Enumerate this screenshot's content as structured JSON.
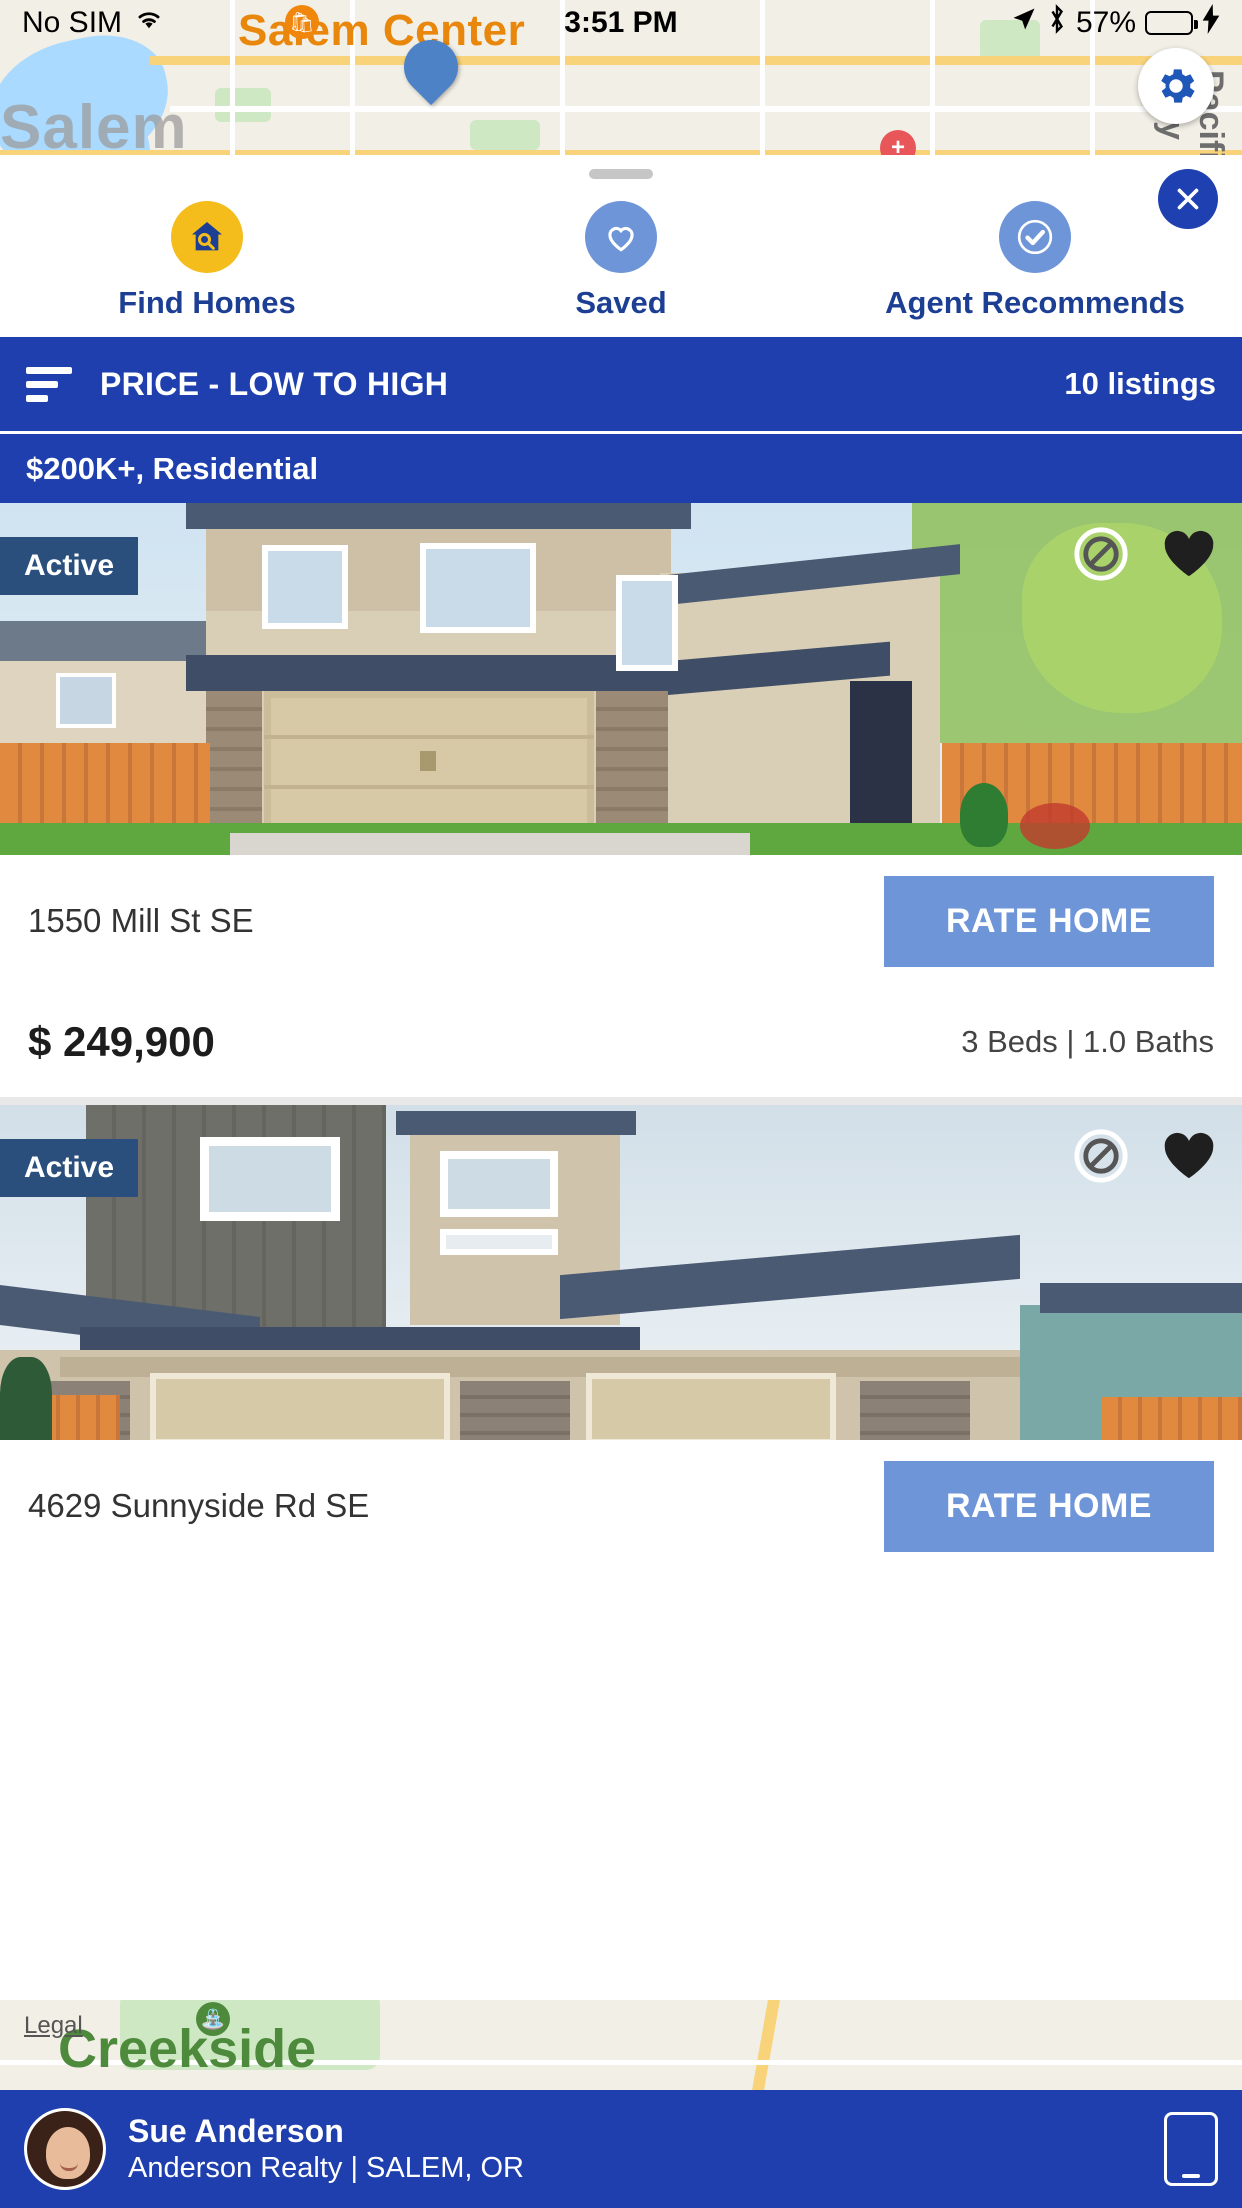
{
  "status_bar": {
    "carrier": "No SIM",
    "wifi_icon": "wifi-icon",
    "time": "3:51 PM",
    "location_icon": "location-arrow-icon",
    "bluetooth_icon": "bluetooth-icon",
    "battery_percent": "57%",
    "charging_icon": "lightning-bolt-icon"
  },
  "map": {
    "city_label": "Salem",
    "center_label": "Salem Center",
    "highway_label": "Pacific Hwy",
    "settings_icon": "gear-icon"
  },
  "sheet": {
    "close_icon": "close-icon",
    "actions": [
      {
        "label": "Find Homes",
        "icon": "home-search-icon",
        "color": "#f5bd1c"
      },
      {
        "label": "Saved",
        "icon": "heart-icon",
        "color": "#6e95d8"
      },
      {
        "label": "Agent Recommends",
        "icon": "check-circle-icon",
        "color": "#6e95d8"
      }
    ],
    "sort": {
      "icon": "sort-icon",
      "label": "PRICE - LOW TO HIGH",
      "count": "10 listings"
    },
    "filter": {
      "label": "$200K+, Residential"
    }
  },
  "listings": [
    {
      "status": "Active",
      "address": "1550 Mill St SE",
      "rate_label": "RATE HOME",
      "price": "$ 249,900",
      "beds_baths": "3 Beds | 1.0 Baths",
      "hide_icon": "hide-listing-icon",
      "favorite_icon": "heart-filled-icon"
    },
    {
      "status": "Active",
      "address": "4629 Sunnyside Rd SE",
      "rate_label": "RATE HOME",
      "price": "",
      "beds_baths": "",
      "hide_icon": "hide-listing-icon",
      "favorite_icon": "heart-filled-icon"
    }
  ],
  "bottom_map": {
    "legal_label": "Legal",
    "place_label": "Creekside",
    "park_icon": "park-icon"
  },
  "agent": {
    "name": "Sue Anderson",
    "company": "Anderson Realty | SALEM, OR",
    "avatar": "agent-avatar",
    "phone_icon": "mobile-phone-icon"
  },
  "colors": {
    "brand_blue": "#1e3fad",
    "accent_blue": "#6e95d8",
    "accent_yellow": "#f5bd1c",
    "status_badge": "#2a4f7c"
  }
}
